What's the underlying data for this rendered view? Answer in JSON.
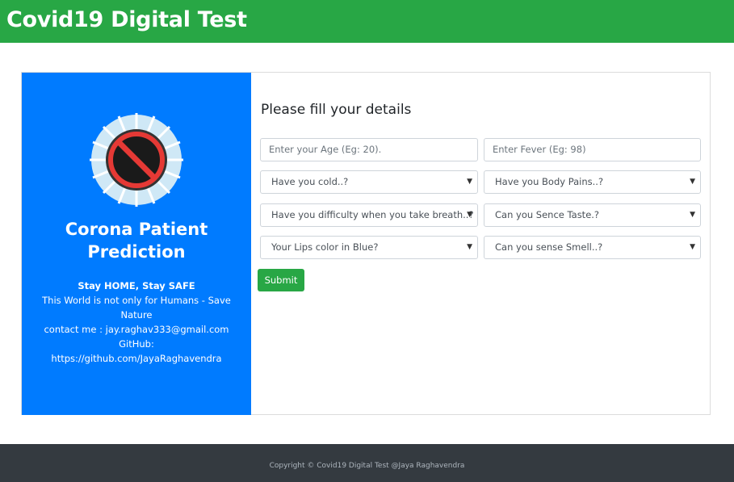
{
  "navbar": {
    "brand": "Covid19 Digital Test"
  },
  "left_panel": {
    "title_line1": "Corona Patient",
    "title_line2": "Prediction",
    "motto": "Stay HOME, Stay SAFE",
    "message": "This World is not only for Humans - Save Nature",
    "contact": "contact me : jay.raghav333@gmail.com",
    "github_label": "GitHub:",
    "github_url": "https://github.com/JayaRaghavendra"
  },
  "form": {
    "title": "Please fill your details",
    "age_placeholder": "Enter your Age (Eg: 20).",
    "fever_placeholder": "Enter Fever (Eg: 98)",
    "cold_select": "Have you cold..?",
    "body_pains_select": "Have you Body Pains..?",
    "breath_select": "Have you difficulty when you take breath..?",
    "taste_select": "Can you Sence Taste.?",
    "lips_select": "Your Lips color in Blue?",
    "smell_select": "Can you sense Smell..?",
    "submit_label": "Submit"
  },
  "footer": {
    "copyright": "Copyright © Covid19 Digital Test @Jaya Raghavendra"
  },
  "colors": {
    "navbar": "#28a745",
    "panel": "#007bff",
    "footer": "#343a40",
    "submit": "#28a745"
  }
}
